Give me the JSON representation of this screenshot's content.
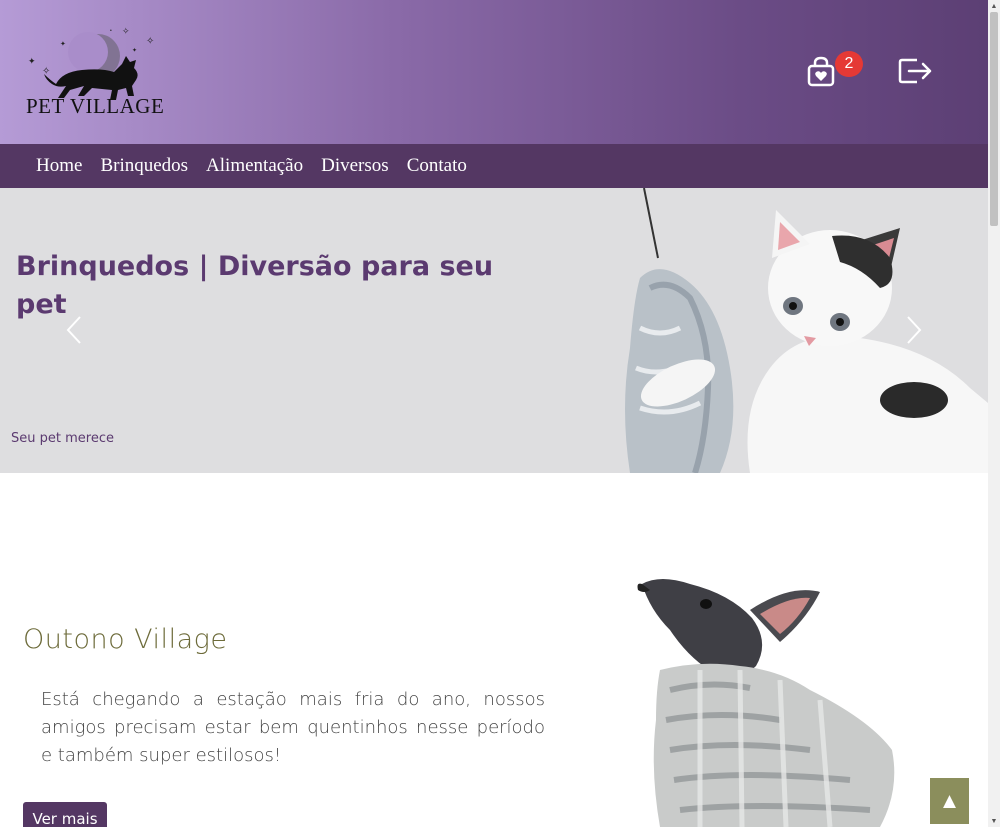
{
  "header": {
    "logo_text": "PET VILLAGE",
    "cart_count": "2"
  },
  "nav": {
    "items": [
      "Home",
      "Brinquedos",
      "Alimentação",
      "Diversos",
      "Contato"
    ]
  },
  "carousel": {
    "title": "Brinquedos | Diversão para seu pet",
    "subtitle": "Seu pet merece"
  },
  "promo": {
    "title": "Outono Village",
    "text": "Está chegando a estação mais fria do ano, nossos amigos precisam estar bem quentinhos nesse período e também super estilosos!",
    "button": "Ver mais"
  },
  "back_to_top": "▲",
  "colors": {
    "primary": "#543763",
    "accent_olive": "#6d6b3a",
    "badge": "#e53935"
  },
  "icons": [
    "cart-icon",
    "logout-icon",
    "chevron-left-icon",
    "chevron-right-icon",
    "arrow-up-icon"
  ]
}
